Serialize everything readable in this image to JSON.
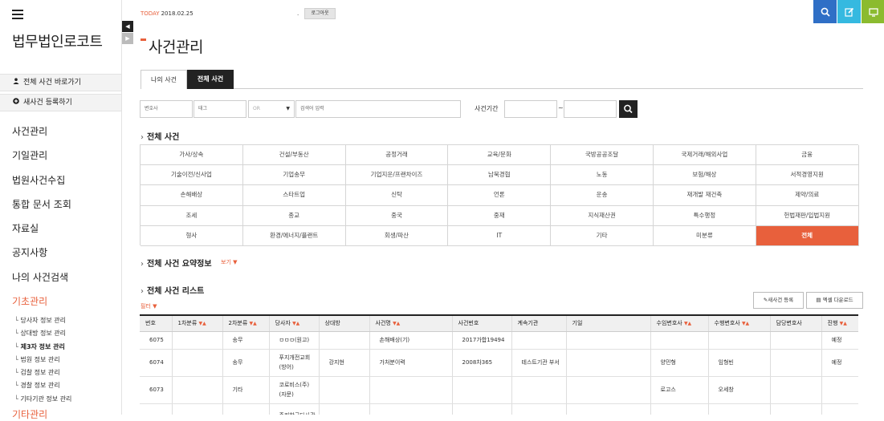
{
  "sidebar": {
    "brand": "법무법인로코트",
    "quick_links": [
      {
        "icon": "user-icon",
        "label": "전체 사건 바로가기"
      },
      {
        "icon": "plus-circle-icon",
        "label": "새사건 등록하기"
      }
    ],
    "menu": [
      {
        "label": "사건관리"
      },
      {
        "label": "기일관리"
      },
      {
        "label": "법원사건수집"
      },
      {
        "label": "통합 문서 조회"
      },
      {
        "label": "자료실"
      },
      {
        "label": "공지사항"
      },
      {
        "label": "나의 사건검색"
      },
      {
        "label": "기초관리",
        "active": true
      }
    ],
    "submenu": [
      {
        "label": "당사자 정보 관리"
      },
      {
        "label": "상대방 정보 관리"
      },
      {
        "label": "제3자 정보 관리"
      },
      {
        "label": "법원 정보 관리"
      },
      {
        "label": "검찰 정보 관리"
      },
      {
        "label": "경찰 정보 관리"
      },
      {
        "label": "기타기관 정보 관리"
      }
    ],
    "cut_item": "기타관리"
  },
  "topbar": {
    "today_label": "TODAY",
    "today_date": "2018.02.25",
    "dot": ".",
    "logout_label": "로그아웃"
  },
  "quick_buttons": [
    {
      "icon": "search-icon",
      "color": "#2f6fc6"
    },
    {
      "icon": "edit-icon",
      "color": "#35b9e0"
    },
    {
      "icon": "monitor-icon",
      "color": "#8bbb2f"
    }
  ],
  "page_title": "사건관리",
  "tabs": [
    {
      "label": "나의 사건",
      "active": false
    },
    {
      "label": "전체 사건",
      "active": true
    }
  ],
  "search": {
    "lawyer_placeholder": "변호사",
    "tag_placeholder": "태그",
    "operator": "OR",
    "keyword_placeholder": "검색어 입력",
    "period_label": "사건기간",
    "tilde": "~"
  },
  "sections": {
    "all_cases": "전체 사건",
    "summary": "전체 사건 요약정보",
    "summary_more": "보기",
    "list": "전체 사건 리스트"
  },
  "categories": [
    "가사/상속",
    "건설/부동산",
    "공정거래",
    "교육/문화",
    "국방공공조달",
    "국제거래/해외사업",
    "금융",
    "기술이전/신사업",
    "기업송무",
    "기업지운/프랜차이즈",
    "남북경협",
    "노동",
    "보험/해상",
    "서적경영지원",
    "손해배상",
    "스타트업",
    "신탁",
    "언론",
    "운송",
    "재개발 재건축",
    "제약/의료",
    "조세",
    "종교",
    "중국",
    "중재",
    "지식재산권",
    "특수행정",
    "헌법재판/입법지원",
    "형사",
    "환경/에너지/플랜트",
    "회생/파산",
    "IT",
    "기타",
    "미분류",
    "전체"
  ],
  "selected_category": "전체",
  "list": {
    "filter_label": "필터",
    "new_case_label": "새사건 등록",
    "excel_label": "엑셀 다운로드",
    "columns": [
      {
        "label": "번호",
        "sort": ""
      },
      {
        "label": "1차분류",
        "sort": "▼▲"
      },
      {
        "label": "2차분류",
        "sort": "▼▲"
      },
      {
        "label": "당사자",
        "sort": "▼▲"
      },
      {
        "label": "상대방",
        "sort": ""
      },
      {
        "label": "사건명",
        "sort": "▼▲"
      },
      {
        "label": "사건번호",
        "sort": ""
      },
      {
        "label": "계속기관",
        "sort": ""
      },
      {
        "label": "기일",
        "sort": ""
      },
      {
        "label": "수임변호사",
        "sort": "▼▲"
      },
      {
        "label": "수행변호사",
        "sort": "▼▲"
      },
      {
        "label": "담당변호사",
        "sort": ""
      },
      {
        "label": "진행",
        "sort": "▼▲"
      }
    ],
    "rows": [
      [
        "6075",
        "",
        "송무",
        "ㅁㅁㅁ(원고)",
        "",
        "손해배상(기)",
        "2017가합19494",
        "",
        "",
        "",
        "",
        "",
        "예정"
      ],
      [
        "6074",
        "",
        "송무",
        "푸지개전교회 (방어)",
        "강지현",
        "가처분이력",
        "2008차365",
        "테스트기관 부서",
        "",
        "양민형",
        "임형빈",
        "",
        "예정"
      ],
      [
        "6073",
        "",
        "기타",
        "코로비스(주)(자문)",
        "",
        "",
        "",
        "",
        "",
        "로고스",
        "오세창",
        "",
        ""
      ],
      [
        "",
        "",
        "",
        "주리한국다사관",
        "",
        "",
        "",
        "",
        "",
        "",
        "",
        "",
        ""
      ]
    ]
  }
}
